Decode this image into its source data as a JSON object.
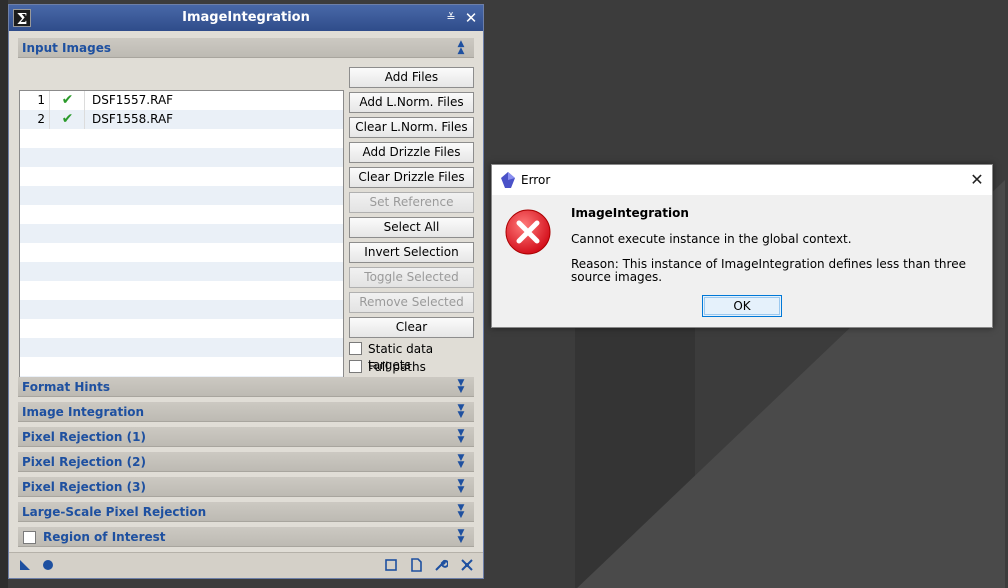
{
  "window": {
    "title": "ImageIntegration",
    "shade_glyph": "≚",
    "close_glyph": "✕"
  },
  "sections": {
    "input_images": "Input Images",
    "format_hints": "Format Hints",
    "image_integration": "Image Integration",
    "pixel_rejection_1": "Pixel Rejection (1)",
    "pixel_rejection_2": "Pixel Rejection (2)",
    "pixel_rejection_3": "Pixel Rejection (3)",
    "large_scale": "Large-Scale Pixel Rejection",
    "region_of_interest": "Region of Interest"
  },
  "files": [
    {
      "index": "1",
      "status": "✔",
      "name": "DSF1557.RAF"
    },
    {
      "index": "2",
      "status": "✔",
      "name": "DSF1558.RAF"
    }
  ],
  "buttons": {
    "add_files": "Add Files",
    "add_lnorm": "Add L.Norm. Files",
    "clear_lnorm": "Clear L.Norm. Files",
    "add_drizzle": "Add Drizzle Files",
    "clear_drizzle": "Clear Drizzle Files",
    "set_reference": "Set Reference",
    "select_all": "Select All",
    "invert_selection": "Invert Selection",
    "toggle_selected": "Toggle Selected",
    "remove_selected": "Remove Selected",
    "clear": "Clear"
  },
  "checkboxes": {
    "static_data_targets": "Static data targets",
    "full_paths": "Full paths"
  },
  "dialog": {
    "title": "Error",
    "heading": "ImageIntegration",
    "message": "Cannot execute instance in the global context.",
    "reason_line1": "Reason: This instance of ImageIntegration defines less than three",
    "reason_line2": "source images.",
    "ok": "OK",
    "close_glyph": "✕"
  },
  "colors": {
    "accent": "#1e50a0",
    "titlebar": "#3a5896",
    "check_green": "#2a9a2a",
    "error_red": "#e0202a"
  }
}
